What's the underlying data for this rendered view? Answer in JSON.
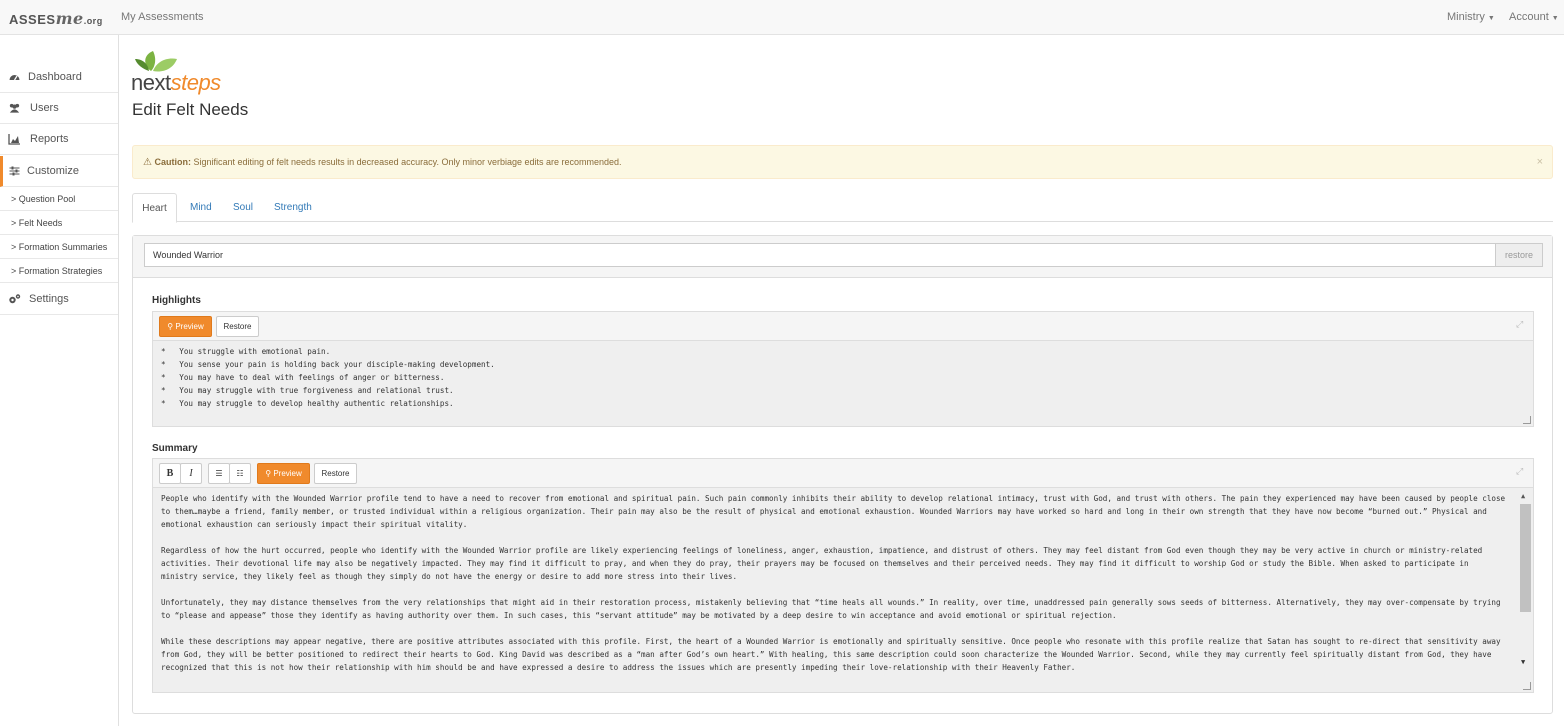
{
  "brand": {
    "part1": "ASSES",
    "part2": "me",
    "part3": ".org"
  },
  "topnav": {
    "my_assessments": "My Assessments",
    "ministry": "Ministry",
    "account": "Account"
  },
  "sidebar": {
    "items": [
      {
        "label": "Dashboard",
        "icon": "dashboard-icon"
      },
      {
        "label": "Users",
        "icon": "users-icon"
      },
      {
        "label": "Reports",
        "icon": "chart-icon"
      },
      {
        "label": "Customize",
        "icon": "sliders-icon"
      },
      {
        "label": "Settings",
        "icon": "gears-icon"
      }
    ],
    "subitems": [
      "> Question Pool",
      "> Felt Needs",
      "> Formation Summaries",
      "> Formation Strategies"
    ]
  },
  "logo": {
    "text1": "next",
    "text2": "steps"
  },
  "page_title": "Edit Felt Needs",
  "alert": {
    "strong": "Caution:",
    "text": " Significant editing of felt needs results in decreased accuracy. Only minor verbiage edits are recommended.",
    "close": "×"
  },
  "tabs": [
    "Heart",
    "Mind",
    "Soul",
    "Strength"
  ],
  "felt_need": {
    "name": "Wounded Warrior",
    "restore": "restore"
  },
  "highlights": {
    "label": "Highlights",
    "preview": "Preview",
    "restore": "Restore",
    "lines": [
      "*   You struggle with emotional pain.",
      "*   You sense your pain is holding back your disciple-making development.",
      "*   You may have to deal with feelings of anger or bitterness.",
      "*   You may struggle with true forgiveness and relational trust.",
      "*   You may struggle to develop healthy authentic relationships."
    ]
  },
  "summary": {
    "label": "Summary",
    "bold": "B",
    "italic": "I",
    "preview": "Preview",
    "restore": "Restore",
    "paragraphs": [
      "People who identify with the Wounded Warrior profile tend to have a need to recover from emotional and spiritual pain. Such pain commonly inhibits their ability to develop relational intimacy, trust with God, and trust with others. The pain they experienced may have been caused by people close to them…maybe a friend, family member, or trusted individual within a religious organization. Their pain may also be the result of physical and emotional exhaustion. Wounded Warriors may have worked so hard and long in their own strength that they have now become “burned out.” Physical and emotional exhaustion can seriously impact their spiritual vitality.",
      "Regardless of how the hurt occurred, people who identify with the Wounded Warrior profile are likely experiencing feelings of loneliness, anger, exhaustion, impatience, and distrust of others. They may feel distant from God even though they may be very active in church or ministry-related activities. Their devotional life may also be negatively impacted. They may find it difficult to pray, and when they do pray, their prayers may be focused on themselves and their perceived needs. They may find it difficult to worship God or study the Bible. When asked to participate in ministry service, they likely feel as though they simply do not have the energy or desire to add more stress into their lives.",
      "Unfortunately, they may distance themselves from the very relationships that might aid in their restoration process, mistakenly believing that “time heals all wounds.” In reality, over time, unaddressed pain generally sows seeds of bitterness. Alternatively, they may over-compensate by trying to “please and appease” those they identify as having authority over them. In such cases, this “servant attitude” may be motivated by a deep desire to win acceptance and avoid emotional or spiritual rejection.",
      "While these descriptions may appear negative, there are positive attributes associated with this profile. First, the heart of a Wounded Warrior is emotionally and spiritually sensitive. Once people who resonate with this profile realize that Satan has sought to re-direct that sensitivity away from God, they will be better positioned to redirect their hearts to God. King David was described as a “man after God’s own heart.” With healing, this same description could soon characterize the Wounded Warrior. Second, while they may currently feel spiritually distant from God, they have recognized that this is not how their relationship with him should be and have expressed a desire to address the issues which are presently impeding their love-relationship with their Heavenly Father."
    ]
  },
  "colors": {
    "accent": "#f08a2c",
    "link": "#337ab7",
    "alert_bg": "#fcf8e3",
    "logo_green": "#7cb342"
  }
}
